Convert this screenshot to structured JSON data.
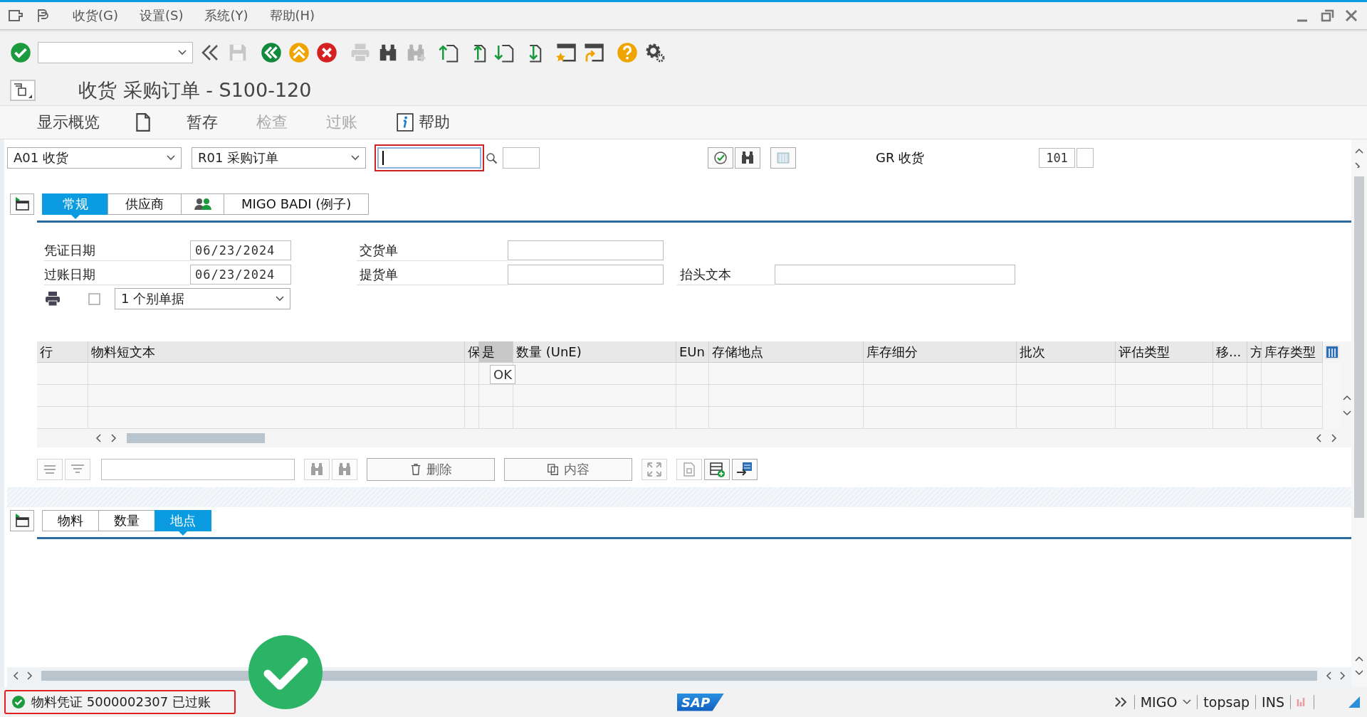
{
  "menu": [
    {
      "label": "收货(G)"
    },
    {
      "label": "设置(S)"
    },
    {
      "label": "系统(Y)"
    },
    {
      "label": "帮助(H)"
    }
  ],
  "toolbar": [
    {
      "kind": "enter",
      "disabled": false
    },
    {
      "kind": "command-field",
      "disabled": false
    },
    {
      "kind": "back-arrows",
      "disabled": false
    },
    {
      "kind": "save",
      "disabled": true
    },
    {
      "kind": "back",
      "disabled": false
    },
    {
      "kind": "exit",
      "disabled": false
    },
    {
      "kind": "cancel",
      "disabled": false
    },
    {
      "kind": "print",
      "disabled": true
    },
    {
      "kind": "find",
      "disabled": false
    },
    {
      "kind": "find-next",
      "disabled": true
    },
    {
      "kind": "first-page",
      "disabled": false
    },
    {
      "kind": "prev-page",
      "disabled": false
    },
    {
      "kind": "next-page",
      "disabled": false
    },
    {
      "kind": "last-page",
      "disabled": false
    },
    {
      "kind": "new-session",
      "disabled": false
    },
    {
      "kind": "shortcut",
      "disabled": false
    },
    {
      "kind": "help",
      "disabled": false
    },
    {
      "kind": "settings",
      "disabled": false
    }
  ],
  "title": "收货 采购订单 - S100-120",
  "app_toolbar": [
    {
      "kind": "text",
      "label": "显示概览",
      "disabled": false
    },
    {
      "kind": "document",
      "disabled": false
    },
    {
      "kind": "text",
      "label": "暂存",
      "disabled": false
    },
    {
      "kind": "text",
      "label": "检查",
      "disabled": true
    },
    {
      "kind": "text",
      "label": "过账",
      "disabled": true
    },
    {
      "kind": "help",
      "label": "帮助",
      "disabled": false
    }
  ],
  "header_row": {
    "action": "A01 收货",
    "reference": "R01 采购订单",
    "movement_label": "GR 收货",
    "movement_type": "101"
  },
  "tabs": [
    {
      "kind": "text",
      "label": "常规",
      "selected": true
    },
    {
      "kind": "text",
      "label": "供应商",
      "selected": false
    },
    {
      "kind": "people",
      "selected": false
    },
    {
      "kind": "text",
      "label": "MIGO BADI (例子)",
      "selected": false
    }
  ],
  "dates": [
    {
      "label": "凭证日期",
      "value": "06/23/2024"
    },
    {
      "label": "过账日期",
      "value": "06/23/2024"
    }
  ],
  "docs": [
    {
      "label": "交货单"
    },
    {
      "label": "提货单"
    }
  ],
  "header_text": {
    "label": "抬头文本"
  },
  "print": {
    "checked": false,
    "option": "1 个别单据"
  },
  "table": {
    "columns": [
      {
        "label": "行",
        "selected": false
      },
      {
        "label": "物料短文本",
        "selected": false
      },
      {
        "label": "保",
        "selected": false
      },
      {
        "label": "是",
        "selected": true
      },
      {
        "label": "数量 (UnE)",
        "selected": false
      },
      {
        "label": "EUn",
        "selected": false
      },
      {
        "label": "存储地点",
        "selected": false
      },
      {
        "label": "库存细分",
        "selected": false
      },
      {
        "label": "批次",
        "selected": false
      },
      {
        "label": "评估类型",
        "selected": false
      },
      {
        "label": "移...",
        "selected": false
      },
      {
        "label": "方",
        "selected": false
      },
      {
        "label": "库存类型",
        "selected": false
      }
    ],
    "tooltip": "OK"
  },
  "table_toolbar": [
    {
      "kind": "sort",
      "disabled": true
    },
    {
      "kind": "filter",
      "disabled": true
    },
    {
      "kind": "field"
    },
    {
      "kind": "find",
      "disabled": true
    },
    {
      "kind": "find-next",
      "disabled": true
    },
    {
      "kind": "delete",
      "label": "删除",
      "disabled": true
    },
    {
      "kind": "content",
      "label": "内容",
      "disabled": true
    },
    {
      "kind": "fullscreen",
      "disabled": true
    },
    {
      "kind": "doc",
      "disabled": true
    },
    {
      "kind": "add-row",
      "disabled": false
    },
    {
      "kind": "transfer",
      "disabled": false
    }
  ],
  "detail_tabs": [
    {
      "label": "物料",
      "selected": false
    },
    {
      "label": "数量",
      "selected": false
    },
    {
      "label": "地点",
      "selected": true
    }
  ],
  "status": {
    "message": "物料凭证 5000002307 已过账",
    "highlighted": true
  },
  "logo": "SAP",
  "status_right": {
    "transaction": "MIGO",
    "server": "topsap",
    "mode": "INS"
  }
}
